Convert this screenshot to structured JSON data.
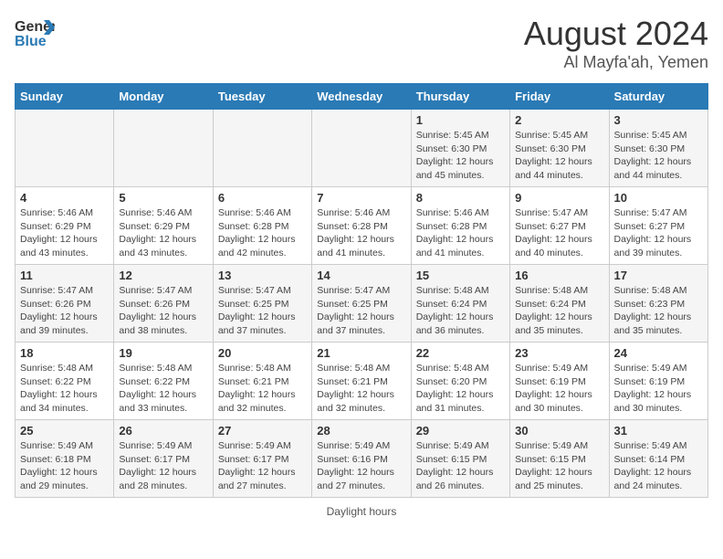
{
  "logo": {
    "text_general": "General",
    "text_blue": "Blue"
  },
  "title": "August 2024",
  "subtitle": "Al Mayfa'ah, Yemen",
  "header": {
    "days": [
      "Sunday",
      "Monday",
      "Tuesday",
      "Wednesday",
      "Thursday",
      "Friday",
      "Saturday"
    ]
  },
  "footer": {
    "label": "Daylight hours"
  },
  "weeks": [
    [
      {
        "day": "",
        "info": ""
      },
      {
        "day": "",
        "info": ""
      },
      {
        "day": "",
        "info": ""
      },
      {
        "day": "",
        "info": ""
      },
      {
        "day": "1",
        "info": "Sunrise: 5:45 AM\nSunset: 6:30 PM\nDaylight: 12 hours\nand 45 minutes."
      },
      {
        "day": "2",
        "info": "Sunrise: 5:45 AM\nSunset: 6:30 PM\nDaylight: 12 hours\nand 44 minutes."
      },
      {
        "day": "3",
        "info": "Sunrise: 5:45 AM\nSunset: 6:30 PM\nDaylight: 12 hours\nand 44 minutes."
      }
    ],
    [
      {
        "day": "4",
        "info": "Sunrise: 5:46 AM\nSunset: 6:29 PM\nDaylight: 12 hours\nand 43 minutes."
      },
      {
        "day": "5",
        "info": "Sunrise: 5:46 AM\nSunset: 6:29 PM\nDaylight: 12 hours\nand 43 minutes."
      },
      {
        "day": "6",
        "info": "Sunrise: 5:46 AM\nSunset: 6:28 PM\nDaylight: 12 hours\nand 42 minutes."
      },
      {
        "day": "7",
        "info": "Sunrise: 5:46 AM\nSunset: 6:28 PM\nDaylight: 12 hours\nand 41 minutes."
      },
      {
        "day": "8",
        "info": "Sunrise: 5:46 AM\nSunset: 6:28 PM\nDaylight: 12 hours\nand 41 minutes."
      },
      {
        "day": "9",
        "info": "Sunrise: 5:47 AM\nSunset: 6:27 PM\nDaylight: 12 hours\nand 40 minutes."
      },
      {
        "day": "10",
        "info": "Sunrise: 5:47 AM\nSunset: 6:27 PM\nDaylight: 12 hours\nand 39 minutes."
      }
    ],
    [
      {
        "day": "11",
        "info": "Sunrise: 5:47 AM\nSunset: 6:26 PM\nDaylight: 12 hours\nand 39 minutes."
      },
      {
        "day": "12",
        "info": "Sunrise: 5:47 AM\nSunset: 6:26 PM\nDaylight: 12 hours\nand 38 minutes."
      },
      {
        "day": "13",
        "info": "Sunrise: 5:47 AM\nSunset: 6:25 PM\nDaylight: 12 hours\nand 37 minutes."
      },
      {
        "day": "14",
        "info": "Sunrise: 5:47 AM\nSunset: 6:25 PM\nDaylight: 12 hours\nand 37 minutes."
      },
      {
        "day": "15",
        "info": "Sunrise: 5:48 AM\nSunset: 6:24 PM\nDaylight: 12 hours\nand 36 minutes."
      },
      {
        "day": "16",
        "info": "Sunrise: 5:48 AM\nSunset: 6:24 PM\nDaylight: 12 hours\nand 35 minutes."
      },
      {
        "day": "17",
        "info": "Sunrise: 5:48 AM\nSunset: 6:23 PM\nDaylight: 12 hours\nand 35 minutes."
      }
    ],
    [
      {
        "day": "18",
        "info": "Sunrise: 5:48 AM\nSunset: 6:22 PM\nDaylight: 12 hours\nand 34 minutes."
      },
      {
        "day": "19",
        "info": "Sunrise: 5:48 AM\nSunset: 6:22 PM\nDaylight: 12 hours\nand 33 minutes."
      },
      {
        "day": "20",
        "info": "Sunrise: 5:48 AM\nSunset: 6:21 PM\nDaylight: 12 hours\nand 32 minutes."
      },
      {
        "day": "21",
        "info": "Sunrise: 5:48 AM\nSunset: 6:21 PM\nDaylight: 12 hours\nand 32 minutes."
      },
      {
        "day": "22",
        "info": "Sunrise: 5:48 AM\nSunset: 6:20 PM\nDaylight: 12 hours\nand 31 minutes."
      },
      {
        "day": "23",
        "info": "Sunrise: 5:49 AM\nSunset: 6:19 PM\nDaylight: 12 hours\nand 30 minutes."
      },
      {
        "day": "24",
        "info": "Sunrise: 5:49 AM\nSunset: 6:19 PM\nDaylight: 12 hours\nand 30 minutes."
      }
    ],
    [
      {
        "day": "25",
        "info": "Sunrise: 5:49 AM\nSunset: 6:18 PM\nDaylight: 12 hours\nand 29 minutes."
      },
      {
        "day": "26",
        "info": "Sunrise: 5:49 AM\nSunset: 6:17 PM\nDaylight: 12 hours\nand 28 minutes."
      },
      {
        "day": "27",
        "info": "Sunrise: 5:49 AM\nSunset: 6:17 PM\nDaylight: 12 hours\nand 27 minutes."
      },
      {
        "day": "28",
        "info": "Sunrise: 5:49 AM\nSunset: 6:16 PM\nDaylight: 12 hours\nand 27 minutes."
      },
      {
        "day": "29",
        "info": "Sunrise: 5:49 AM\nSunset: 6:15 PM\nDaylight: 12 hours\nand 26 minutes."
      },
      {
        "day": "30",
        "info": "Sunrise: 5:49 AM\nSunset: 6:15 PM\nDaylight: 12 hours\nand 25 minutes."
      },
      {
        "day": "31",
        "info": "Sunrise: 5:49 AM\nSunset: 6:14 PM\nDaylight: 12 hours\nand 24 minutes."
      }
    ]
  ]
}
